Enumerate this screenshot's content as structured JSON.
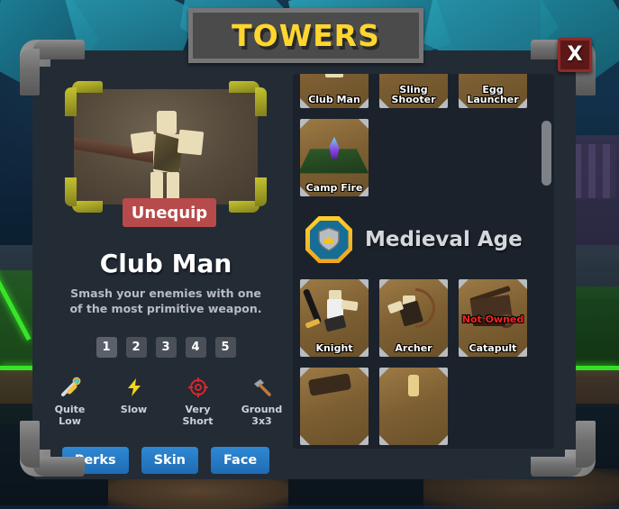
{
  "window": {
    "title": "TOWERS",
    "close_label": "X"
  },
  "left_panel": {
    "unequip_label": "Unequip",
    "tower_name": "Club Man",
    "tower_description": "Smash your enemies with one of the most primitive weapon.",
    "levels": [
      {
        "label": "1",
        "selected": true
      },
      {
        "label": "2",
        "selected": false
      },
      {
        "label": "3",
        "selected": false
      },
      {
        "label": "4",
        "selected": false
      },
      {
        "label": "5",
        "selected": false
      }
    ],
    "stats": [
      {
        "icon": "sword-icon",
        "label": "Quite Low"
      },
      {
        "icon": "lightning-icon",
        "label": "Slow"
      },
      {
        "icon": "target-icon",
        "label": "Very Short"
      },
      {
        "icon": "hammer-icon",
        "label": "Ground 3x3"
      }
    ],
    "actions": [
      {
        "label": "Perks"
      },
      {
        "label": "Skin"
      },
      {
        "label": "Face"
      }
    ]
  },
  "right_panel": {
    "top_section_towers": [
      {
        "name": "Club Man",
        "owned": true,
        "art": "clubman"
      },
      {
        "name": "Sling Shooter",
        "owned": true,
        "art": "sling"
      },
      {
        "name": "Egg Launcher",
        "owned": true,
        "art": "egg"
      },
      {
        "name": "Camp Fire",
        "owned": true,
        "art": "campfire"
      }
    ],
    "age_section": {
      "badge_icon": "shield-crown-icon",
      "title": "Medieval Age",
      "towers": [
        {
          "name": "Knight",
          "owned": true,
          "art": "knight"
        },
        {
          "name": "Archer",
          "owned": true,
          "art": "archer"
        },
        {
          "name": "Catapult",
          "owned": false,
          "not_owned_label": "Not Owned",
          "art": "catapult"
        },
        {
          "name": "",
          "owned": true,
          "art": "partial_a"
        },
        {
          "name": "",
          "owned": true,
          "art": "partial_b"
        }
      ]
    },
    "scrollbar": {
      "visible": true
    }
  },
  "colors": {
    "title_yellow": "#ffd62e",
    "unequip_red": "#b74a4a",
    "action_blue": "#2f88d4",
    "not_owned_red": "#ff2020",
    "card_brown": "#9c7a45",
    "badge_gold": "#ffd22e",
    "panel_bg": "#232b35"
  }
}
